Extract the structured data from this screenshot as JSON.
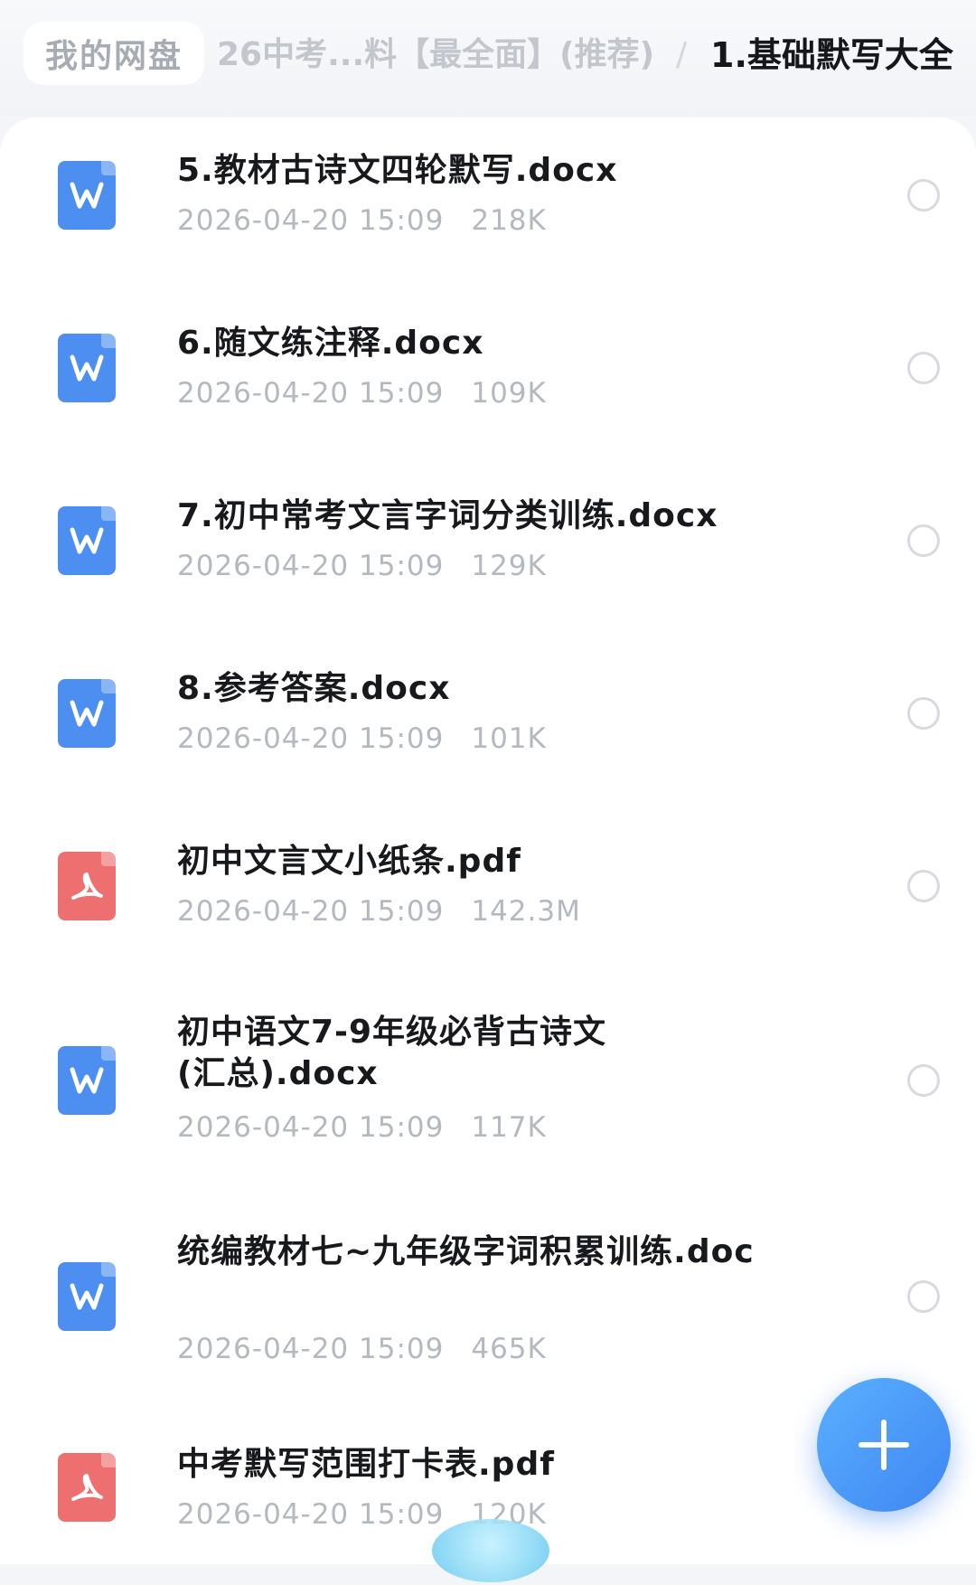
{
  "breadcrumb": {
    "home": "我的网盘",
    "middle": "26中考...料【最全面】(推荐)",
    "separator": "/",
    "current": "1.基础默写大全"
  },
  "files": [
    {
      "name": "5.教材古诗文四轮默写.docx",
      "date": "2026-04-20 15:09",
      "size": "218K",
      "type": "word"
    },
    {
      "name": "6.随文练注释.docx",
      "date": "2026-04-20 15:09",
      "size": "109K",
      "type": "word"
    },
    {
      "name": "7.初中常考文言字词分类训练.docx",
      "date": "2026-04-20 15:09",
      "size": "129K",
      "type": "word"
    },
    {
      "name": "8.参考答案.docx",
      "date": "2026-04-20 15:09",
      "size": "101K",
      "type": "word"
    },
    {
      "name": "初中文言文小纸条.pdf",
      "date": "2026-04-20 15:09",
      "size": "142.3M",
      "type": "pdf"
    },
    {
      "name": "初中语文7-9年级必背古诗文(汇总).docx",
      "date": "2026-04-20 15:09",
      "size": "117K",
      "type": "word"
    },
    {
      "name": "统编教材七~九年级字词积累训练.doc",
      "date": "2026-04-20 15:09",
      "size": "465K",
      "type": "word"
    },
    {
      "name": "中考默写范围打卡表.pdf",
      "date": "2026-04-20 15:09",
      "size": "120K",
      "type": "pdf"
    }
  ],
  "icons": {
    "word": "word-file-icon",
    "pdf": "pdf-file-icon",
    "fab": "plus-icon"
  },
  "colors": {
    "word": "#4d8ff0",
    "pdf": "#ee6f6f",
    "fab": "#3e86f2"
  }
}
